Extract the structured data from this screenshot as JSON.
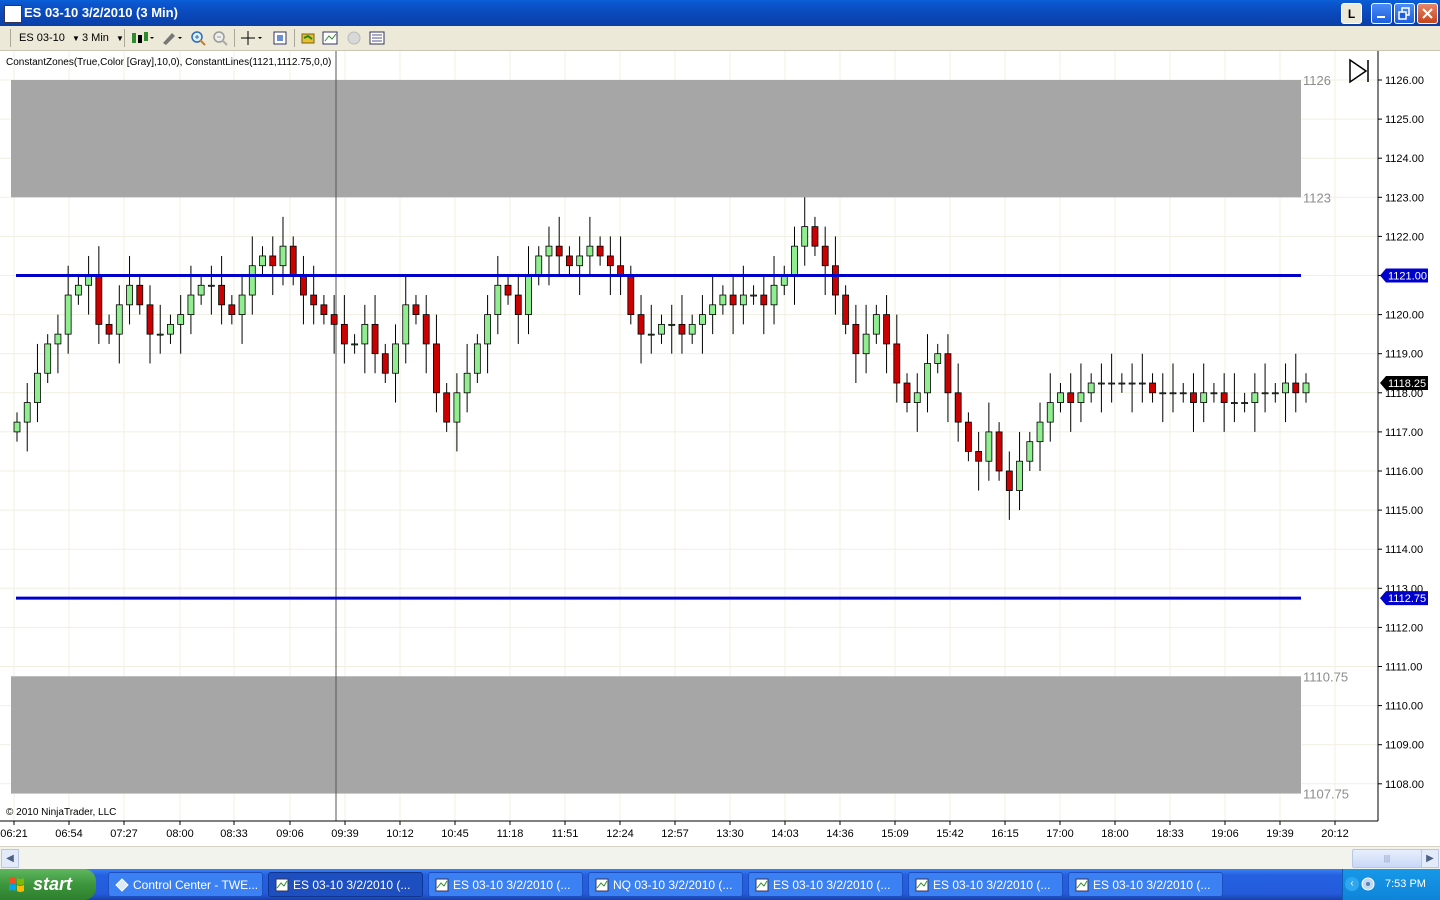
{
  "window": {
    "title": "ES 03-10  3/2/2010 (3 Min)",
    "buttons": {
      "help": "L"
    }
  },
  "toolbar": {
    "instrument": "ES 03-10",
    "interval": "3 Min"
  },
  "chart": {
    "indicator_label": "ConstantZones(True,Color [Gray],10,0), ConstantLines(1121,1112.75,0,0)",
    "copyright": "© 2010 NinjaTrader, LLC",
    "zone_labels": {
      "upper_top": "1126",
      "upper_bottom": "1123",
      "lower_top": "1110.75",
      "lower_bottom": "1107.75"
    },
    "zone_color": "#a6a6a6",
    "line_color": "#0000cc",
    "up_color": "#90ee90",
    "down_color": "#cc0000",
    "last_price_label": "1118.25",
    "line_labels": [
      "1121.00",
      "1112.75"
    ]
  },
  "chart_data": {
    "type": "candlestick",
    "y_ticks": [
      "1126.00",
      "1125.00",
      "1124.00",
      "1123.00",
      "1122.00",
      "1121.00",
      "1120.00",
      "1119.00",
      "1118.00",
      "1117.00",
      "1116.00",
      "1115.00",
      "1114.00",
      "1113.00",
      "1112.00",
      "1111.00",
      "1110.00",
      "1109.00",
      "1108.00"
    ],
    "x_ticks": [
      "06:21",
      "06:54",
      "07:27",
      "08:00",
      "08:33",
      "09:06",
      "09:39",
      "10:12",
      "10:45",
      "11:18",
      "11:51",
      "12:24",
      "12:57",
      "13:30",
      "14:03",
      "14:36",
      "15:09",
      "15:42",
      "16:15",
      "17:00",
      "18:00",
      "18:33",
      "19:06",
      "19:39",
      "20:12"
    ],
    "ylim": [
      1107.5,
      1126.5
    ],
    "zones": [
      {
        "from": 1123,
        "to": 1126
      },
      {
        "from": 1107.75,
        "to": 1110.75
      }
    ],
    "lines": [
      1121.0,
      1112.75
    ],
    "last_price": 1118.25,
    "close_series": [
      1117.25,
      1117.75,
      1118.5,
      1119.25,
      1119.5,
      1120.5,
      1120.75,
      1121.0,
      1119.75,
      1119.5,
      1120.25,
      1120.75,
      1120.25,
      1119.5,
      1119.5,
      1119.75,
      1120.0,
      1120.5,
      1120.75,
      1120.75,
      1120.25,
      1120.0,
      1120.5,
      1121.25,
      1121.5,
      1121.25,
      1121.75,
      1121.0,
      1120.5,
      1120.25,
      1120.0,
      1119.75,
      1119.25,
      1119.25,
      1119.75,
      1119.0,
      1118.5,
      1119.25,
      1120.25,
      1120.0,
      1119.25,
      1118.0,
      1117.25,
      1118.0,
      1118.5,
      1119.25,
      1120.0,
      1120.75,
      1120.5,
      1120.0,
      1121.0,
      1121.5,
      1121.75,
      1121.5,
      1121.25,
      1121.5,
      1121.75,
      1121.5,
      1121.25,
      1121.0,
      1120.0,
      1119.5,
      1119.5,
      1119.75,
      1119.75,
      1119.5,
      1119.75,
      1120.0,
      1120.25,
      1120.5,
      1120.25,
      1120.5,
      1120.5,
      1120.25,
      1120.75,
      1121.0,
      1121.75,
      1122.25,
      1121.75,
      1121.25,
      1120.5,
      1119.75,
      1119.0,
      1119.5,
      1120.0,
      1119.25,
      1118.25,
      1117.75,
      1118.0,
      1118.75,
      1119.0,
      1118.0,
      1117.25,
      1116.5,
      1116.25,
      1117.0,
      1116.0,
      1115.5,
      1116.25,
      1116.75,
      1117.25,
      1117.75,
      1118.0,
      1117.75,
      1118.0,
      1118.25,
      1118.25,
      1118.25,
      1118.25,
      1118.25,
      1118.25,
      1118.0,
      1118.0,
      1118.0,
      1118.0,
      1117.75,
      1118.0,
      1118.0,
      1117.75,
      1117.75,
      1117.75,
      1118.0,
      1118.0,
      1118.0,
      1118.25,
      1118.0,
      1118.25
    ]
  },
  "taskbar": {
    "start_label": "start",
    "tasks": [
      "Control Center - TWE...",
      "ES 03-10  3/2/2010 (...",
      "ES 03-10  3/2/2010 (...",
      "NQ 03-10  3/2/2010 (...",
      "ES 03-10  3/2/2010 (...",
      "ES 03-10  3/2/2010 (...",
      "ES 03-10  3/2/2010 (..."
    ],
    "clock": "7:53 PM"
  }
}
